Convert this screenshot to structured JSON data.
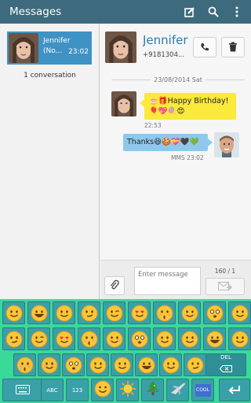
{
  "header": {
    "title": "Messages",
    "icons": [
      "compose-icon",
      "search-icon",
      "more-icon"
    ],
    "background": "#3d6b7d"
  },
  "threads": [
    {
      "name": "Jennifer",
      "preview": "(No...",
      "time": "23:02"
    }
  ],
  "conversation_count": "1 conversation",
  "contact": {
    "name": "Jennifer",
    "phone": "+9181304...",
    "buttons": [
      "call-icon",
      "delete-icon"
    ]
  },
  "date_separator": "23/08/2014 Sat",
  "messages": [
    {
      "direction": "in",
      "text": "🎂🎁Happy Birthday!",
      "line2": "🎈💖🍭😍",
      "time": "22:53",
      "bubble_color": "#fbe93c"
    },
    {
      "direction": "out",
      "text": "Thanks😆🍪💝🖤💚",
      "time": "MMS 23:02",
      "bubble_color": "#8fc8ec"
    }
  ],
  "compose": {
    "placeholder": "Enter message",
    "counter": "160 / 1"
  },
  "keyboard": {
    "background": "#39d99a",
    "key_color": "#3aa0a8",
    "delete_label": "DEL",
    "bottom_row": {
      "keyboard_icon": "keyboard-icon",
      "abc_label": "ABC",
      "num_label": "123",
      "cool_label": "COOL",
      "categories": [
        "smiley-icon",
        "sun-icon",
        "christmas-tree-icon",
        "airplane-icon"
      ]
    }
  }
}
